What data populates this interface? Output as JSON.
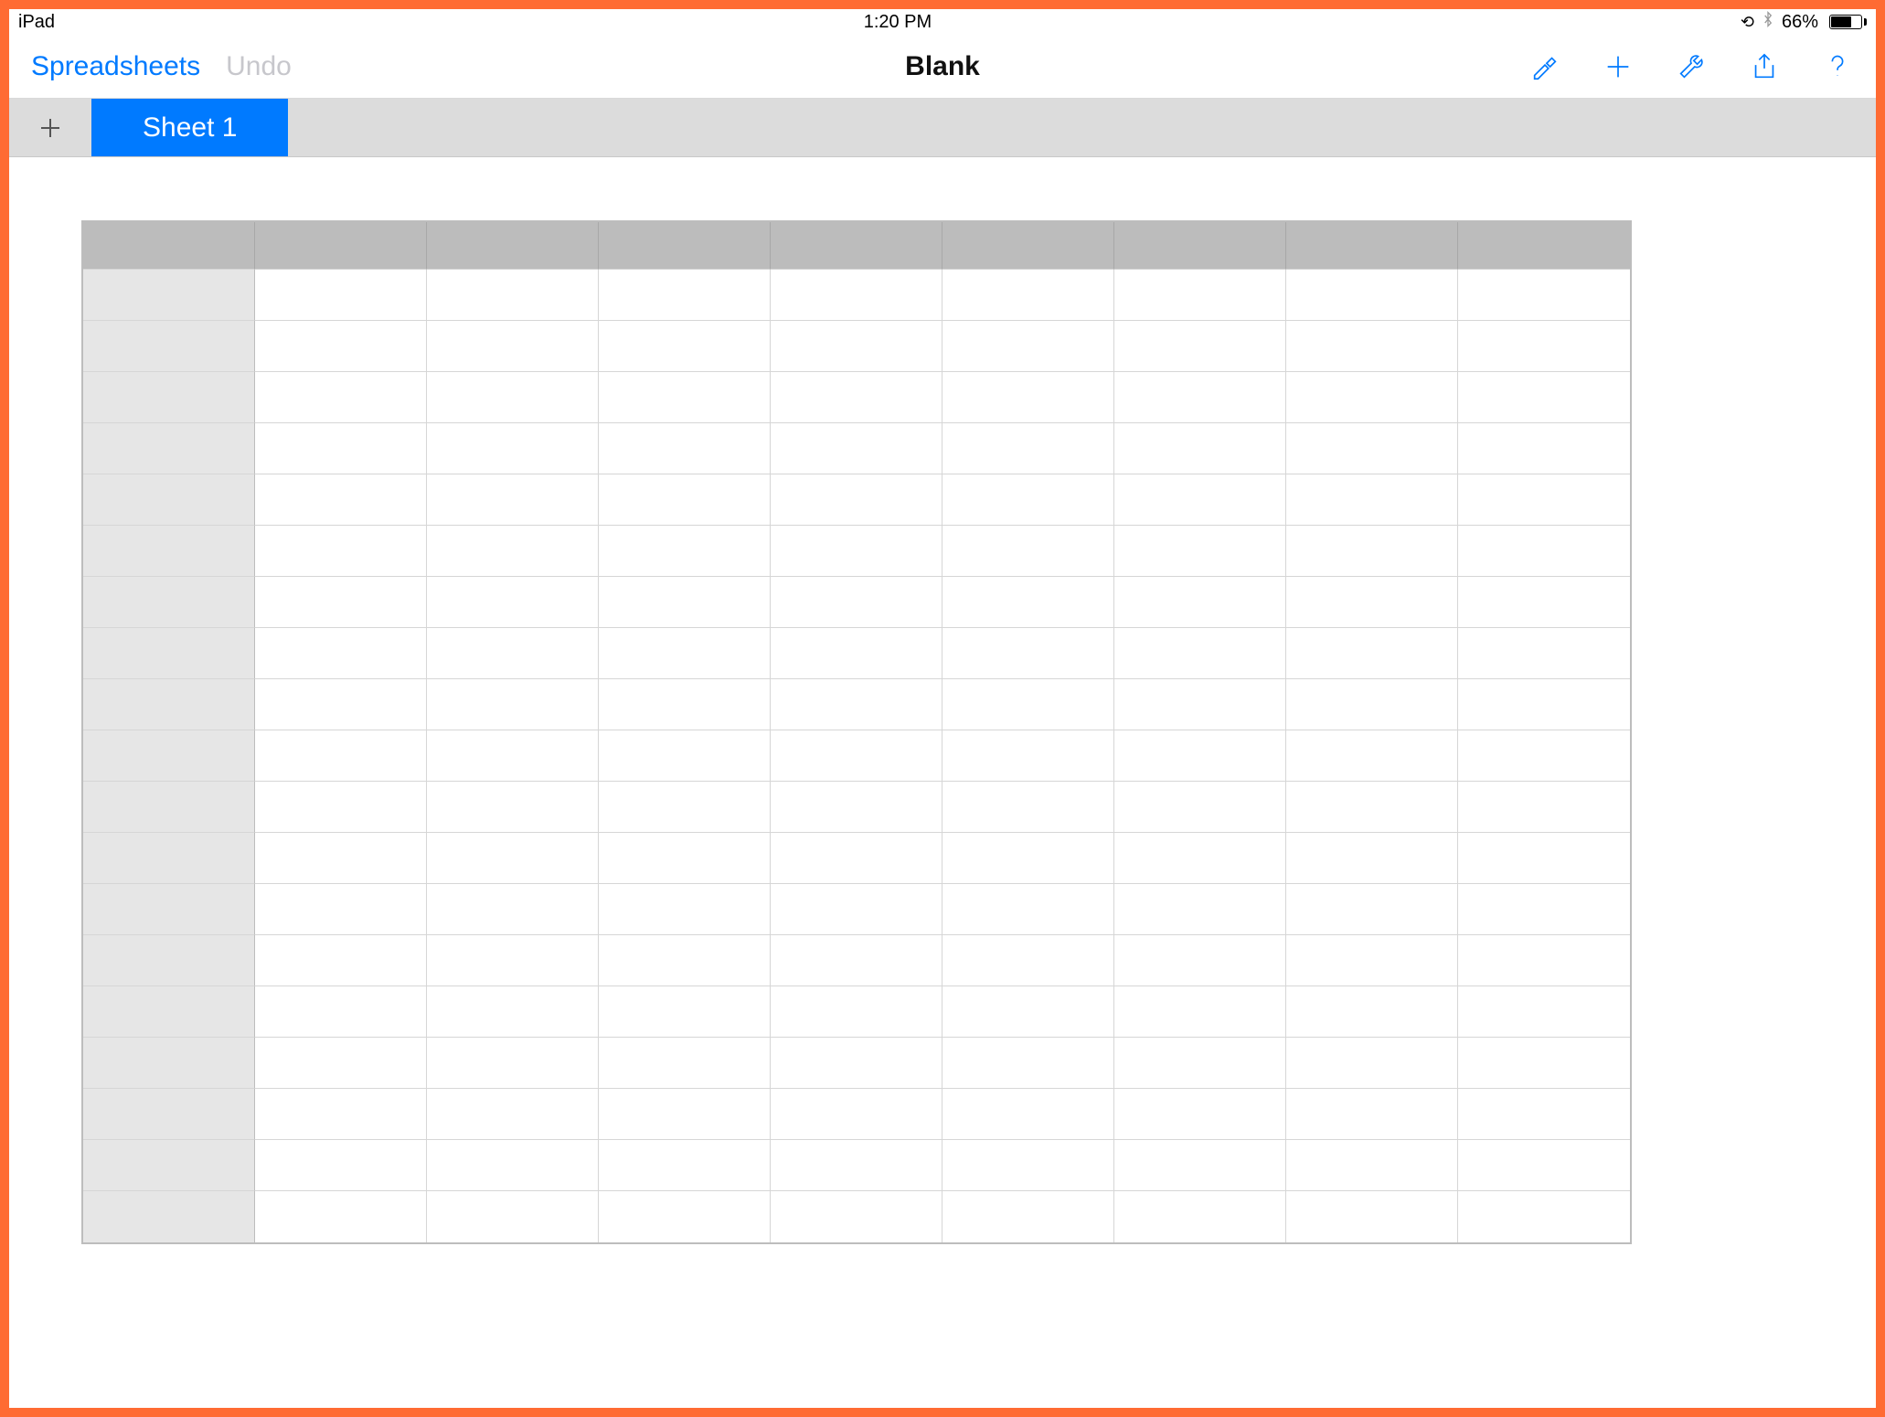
{
  "status_bar": {
    "device": "iPad",
    "time": "1:20 PM",
    "battery_percent": "66%",
    "icons": {
      "orientation_lock": "orientation-lock-icon",
      "bluetooth": "bluetooth-icon"
    }
  },
  "toolbar": {
    "back_label": "Spreadsheets",
    "undo_label": "Undo",
    "title": "Blank",
    "buttons": {
      "brush": "format-brush-icon",
      "plus": "add-icon",
      "wrench": "tools-icon",
      "share": "share-icon",
      "help": "help-icon"
    }
  },
  "sheet_bar": {
    "add_label": "+",
    "tabs": [
      {
        "label": "Sheet 1",
        "active": true
      }
    ]
  },
  "spreadsheet": {
    "columns": 9,
    "rows": 19,
    "column_headers": [
      "",
      "",
      "",
      "",
      "",
      "",
      "",
      "",
      ""
    ],
    "row_headers": [
      "",
      "",
      "",
      "",
      "",
      "",
      "",
      "",
      "",
      "",
      "",
      "",
      "",
      "",
      "",
      "",
      "",
      "",
      ""
    ],
    "cells": []
  },
  "colors": {
    "accent": "#007aff",
    "frame": "#ff6b33",
    "tab_bar": "#dcdcdc",
    "header_fill": "#bcbcbc",
    "row_header_fill": "#e6e6e6"
  }
}
